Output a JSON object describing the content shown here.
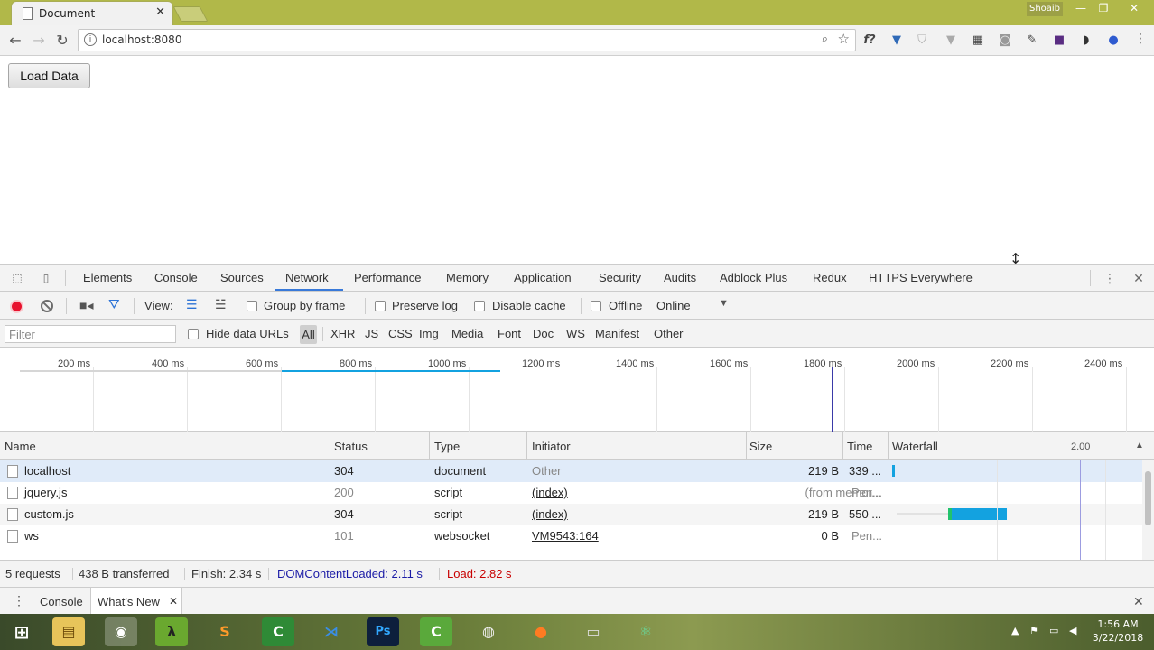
{
  "browser": {
    "tab_title": "Document",
    "tab_close": "✕",
    "user_name": "Shoaib",
    "url": "localhost:8080",
    "window_controls": {
      "minimize": "—",
      "restore": "❐",
      "close": "✕"
    },
    "nav": {
      "back": "←",
      "forward": "→",
      "reload": "↻"
    }
  },
  "page": {
    "load_button": "Load Data"
  },
  "devtools": {
    "tabs": [
      "Elements",
      "Console",
      "Sources",
      "Network",
      "Performance",
      "Memory",
      "Application",
      "Security",
      "Audits",
      "Adblock Plus",
      "Redux",
      "HTTPS Everywhere"
    ],
    "active_tab": "Network",
    "toolbar": {
      "view_label": "View:",
      "group_by_frame": "Group by frame",
      "preserve_log": "Preserve log",
      "disable_cache": "Disable cache",
      "offline": "Offline",
      "throttle": "Online"
    },
    "filter": {
      "placeholder": "Filter",
      "hide_data_urls": "Hide data URLs",
      "types": [
        "All",
        "XHR",
        "JS",
        "CSS",
        "Img",
        "Media",
        "Font",
        "Doc",
        "WS",
        "Manifest",
        "Other"
      ]
    },
    "overview_ticks": [
      "200 ms",
      "400 ms",
      "600 ms",
      "800 ms",
      "1000 ms",
      "1200 ms",
      "1400 ms",
      "1600 ms",
      "1800 ms",
      "2000 ms",
      "2200 ms",
      "2400 ms"
    ],
    "columns": {
      "name": "Name",
      "status": "Status",
      "type": "Type",
      "initiator": "Initiator",
      "size": "Size",
      "time": "Time",
      "waterfall": "Waterfall",
      "waterfall_scale": "2.00"
    },
    "rows": [
      {
        "name": "localhost",
        "status": "304",
        "type": "document",
        "initiator": "Other",
        "size": "219 B",
        "time": "339 ..."
      },
      {
        "name": "jquery.js",
        "status": "200",
        "type": "script",
        "initiator": "(index)",
        "size": "(from memor...",
        "time": "Pen..."
      },
      {
        "name": "custom.js",
        "status": "304",
        "type": "script",
        "initiator": "(index)",
        "size": "219 B",
        "time": "550 ..."
      },
      {
        "name": "ws",
        "status": "101",
        "type": "websocket",
        "initiator": "VM9543:164",
        "size": "0 B",
        "time": "Pen..."
      }
    ],
    "summary": {
      "requests": "5 requests",
      "transferred": "438 B transferred",
      "finish": "Finish: 2.34 s",
      "dom_content_loaded": "DOMContentLoaded: 2.11 s",
      "load": "Load: 2.82 s"
    },
    "drawer": {
      "console": "Console",
      "whats_new": "What's New"
    }
  },
  "taskbar": {
    "time": "1:56 AM",
    "date": "3/22/2018"
  },
  "colors": {
    "titlebar": "#b1b849",
    "accent_blue": "#3879d9",
    "record_red": "#e8112d",
    "dom_loaded": "#1a1aa6",
    "load": "#c80000",
    "waterfall_bar": "#13a2e0"
  }
}
